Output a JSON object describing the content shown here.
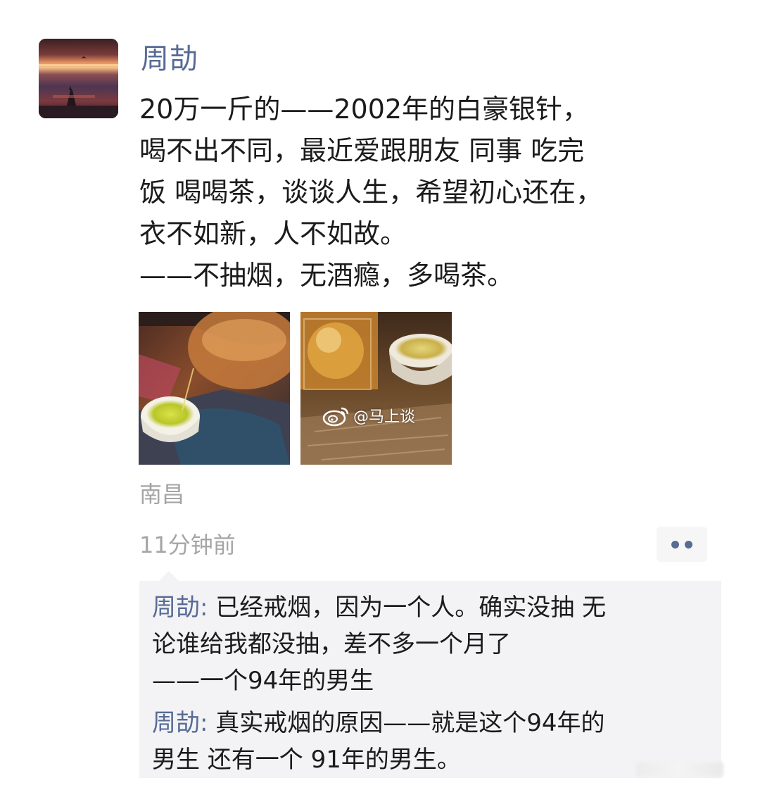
{
  "post": {
    "author": "周劼",
    "text_lines": [
      "20万一斤的——2002年的白豪银针，",
      "喝不出不同，最近爱跟朋友 同事 吃完",
      "饭 喝喝茶，谈谈人生，希望初心还在，",
      "衣不如新，人不如故。",
      "——不抽烟，无酒瘾，多喝茶。"
    ],
    "watermark": "@马上谈",
    "location": "南昌",
    "time": "11分钟前"
  },
  "comments": [
    {
      "author": "周劼",
      "separator": ":",
      "lines": [
        " 已经戒烟，因为一个人。确实没抽 无",
        "论谁给我都没抽，差不多一个月了",
        "——一个94年的男生"
      ]
    },
    {
      "author": "周劼",
      "separator": ":",
      "lines": [
        " 真实戒烟的原因——就是这个94年的",
        "男生 还有一个  91年的男生。"
      ]
    }
  ],
  "icons": {
    "avatar": "sunset-avatar",
    "more": "more-dots-icon",
    "weibo": "weibo-icon"
  },
  "colors": {
    "link": "#576b95",
    "meta": "#a5a5a5",
    "comment_bg": "#f3f3f5"
  }
}
